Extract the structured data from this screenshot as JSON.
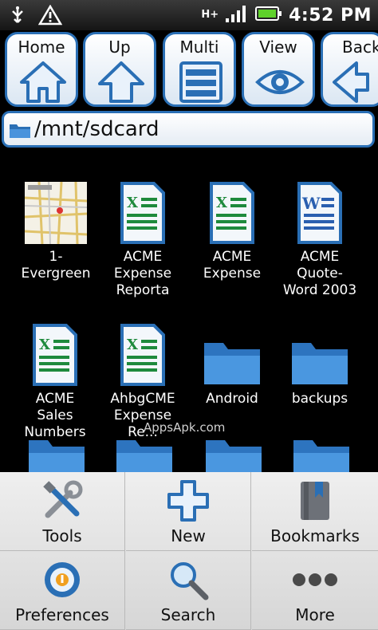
{
  "status_bar": {
    "time": "4:52 PM",
    "network": "H+"
  },
  "toolbar": {
    "home": "Home",
    "up": "Up",
    "multi": "Multi",
    "view": "View",
    "back": "Back"
  },
  "path": {
    "current": "/mnt/sdcard"
  },
  "files": [
    {
      "name": "1-\nEvergreen",
      "kind": "image-thumb"
    },
    {
      "name": "ACME\nExpense\nReporta",
      "kind": "excel"
    },
    {
      "name": "ACME\nExpense",
      "kind": "excel"
    },
    {
      "name": "ACME\nQuote-\nWord 2003",
      "kind": "word"
    },
    {
      "name": "ACME\nSales\nNumbers",
      "kind": "excel"
    },
    {
      "name": "AhbgCME\nExpense\nRe...",
      "kind": "excel"
    },
    {
      "name": "Android",
      "kind": "folder"
    },
    {
      "name": "backups",
      "kind": "folder"
    }
  ],
  "watermark": "AppsApk.com",
  "menu": {
    "tools": "Tools",
    "new": "New",
    "bookmarks": "Bookmarks",
    "preferences": "Preferences",
    "search": "Search",
    "more": "More"
  },
  "colors": {
    "accent": "#2a6fb5",
    "excel": "#1e8a3c",
    "word": "#2a5fb0",
    "folder": "#3b86d1"
  }
}
